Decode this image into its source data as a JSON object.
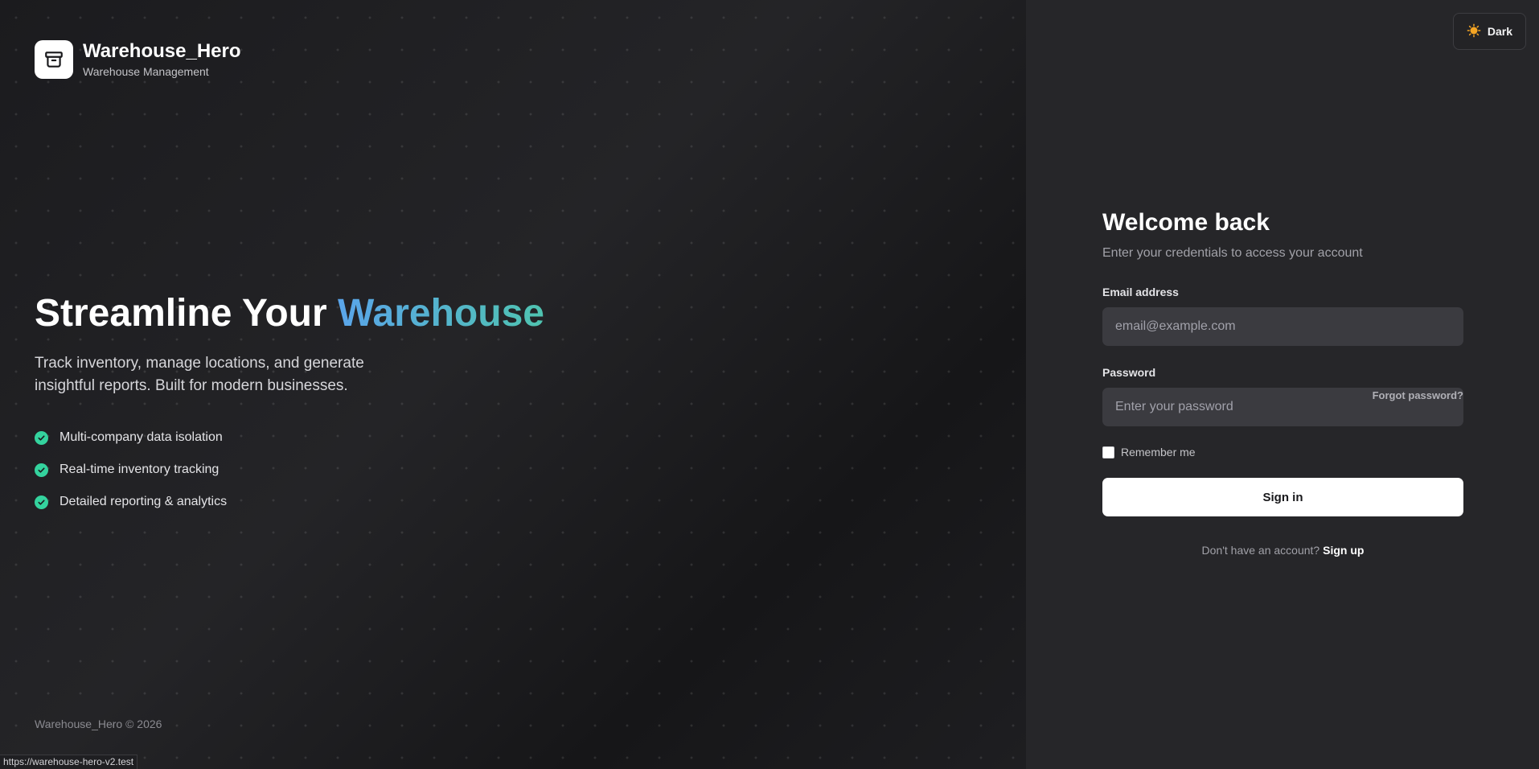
{
  "brand": {
    "name": "Warehouse_Hero",
    "subtitle": "Warehouse Management"
  },
  "hero": {
    "headline_prefix": "Streamline Your ",
    "headline_accent": "Warehouse",
    "lead": "Track inventory, manage locations, and generate insightful reports. Built for modern businesses.",
    "features": [
      {
        "label": "Multi-company data isolation"
      },
      {
        "label": "Real-time inventory tracking"
      },
      {
        "label": "Detailed reporting & analytics"
      }
    ],
    "copyright": "Warehouse_Hero © 2026"
  },
  "status_bar": {
    "url": "https://warehouse-hero-v2.test"
  },
  "theme_toggle": {
    "label": "Dark",
    "icon": "sun-icon"
  },
  "login": {
    "title": "Welcome back",
    "subtitle": "Enter your credentials to access your account",
    "email_label": "Email address",
    "email_placeholder": "email@example.com",
    "email_value": "",
    "password_label": "Password",
    "password_placeholder": "Enter your password",
    "password_value": "",
    "forgot_label": "Forgot password?",
    "remember_label": "Remember me",
    "remember_checked": false,
    "signin_label": "Sign in",
    "signup_prompt": "Don't have an account?",
    "signup_label": "Sign up"
  },
  "colors": {
    "accent_start": "#5aa5ea",
    "accent_end": "#4fc3b0",
    "check": "#34d39e",
    "sun": "#f5a524"
  }
}
